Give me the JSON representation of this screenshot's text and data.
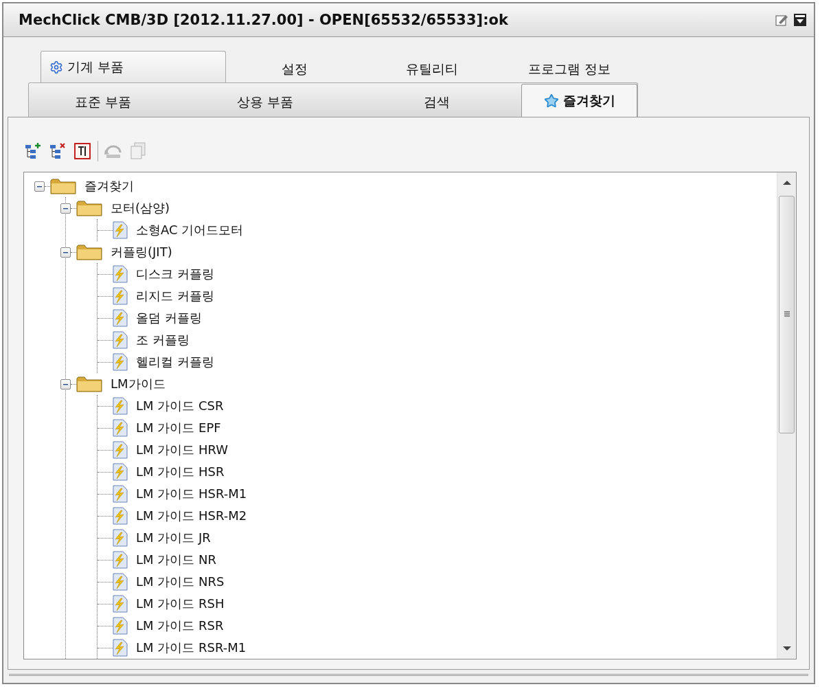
{
  "window": {
    "title": "MechClick CMB/3D [2012.11.27.00] - OPEN[65532/65533]:ok"
  },
  "main_tabs": [
    {
      "label": "기계 부품",
      "selected": true
    },
    {
      "label": "설정",
      "selected": false
    },
    {
      "label": "유틸리티",
      "selected": false
    },
    {
      "label": "프로그램 정보",
      "selected": false
    }
  ],
  "sub_tabs": [
    {
      "label": "표준 부품",
      "selected": false
    },
    {
      "label": "상용 부품",
      "selected": false
    },
    {
      "label": "검색",
      "selected": false
    },
    {
      "label": "즐겨찾기",
      "selected": true
    }
  ],
  "toolbar": [
    {
      "kind": "add-folder",
      "disabled": false
    },
    {
      "kind": "remove-folder",
      "disabled": false
    },
    {
      "kind": "rename",
      "disabled": false
    },
    {
      "kind": "undo",
      "disabled": true
    },
    {
      "kind": "copy",
      "disabled": true
    }
  ],
  "tree": [
    {
      "label": "즐겨찾기",
      "kind": "folder",
      "expanded": true,
      "children": [
        {
          "label": "모터(삼양)",
          "kind": "folder",
          "expanded": true,
          "children": [
            {
              "label": "소형AC 기어드모터",
              "kind": "item"
            }
          ]
        },
        {
          "label": "커플링(JIT)",
          "kind": "folder",
          "expanded": true,
          "children": [
            {
              "label": "디스크 커플링",
              "kind": "item"
            },
            {
              "label": "리지드 커플링",
              "kind": "item"
            },
            {
              "label": "올덤 커플링",
              "kind": "item"
            },
            {
              "label": "조 커플링",
              "kind": "item"
            },
            {
              "label": "헬리컬 커플링",
              "kind": "item"
            }
          ]
        },
        {
          "label": "LM가이드",
          "kind": "folder",
          "expanded": true,
          "children": [
            {
              "label": "LM 가이드 CSR",
              "kind": "item"
            },
            {
              "label": "LM 가이드 EPF",
              "kind": "item"
            },
            {
              "label": "LM 가이드 HRW",
              "kind": "item"
            },
            {
              "label": "LM 가이드 HSR",
              "kind": "item"
            },
            {
              "label": "LM 가이드 HSR-M1",
              "kind": "item"
            },
            {
              "label": "LM 가이드 HSR-M2",
              "kind": "item"
            },
            {
              "label": "LM 가이드 JR",
              "kind": "item"
            },
            {
              "label": "LM 가이드 NR",
              "kind": "item"
            },
            {
              "label": "LM 가이드 NRS",
              "kind": "item"
            },
            {
              "label": "LM 가이드 RSH",
              "kind": "item"
            },
            {
              "label": "LM 가이드 RSR",
              "kind": "item"
            },
            {
              "label": "LM 가이드 RSR-M1",
              "kind": "item"
            }
          ]
        }
      ]
    }
  ]
}
